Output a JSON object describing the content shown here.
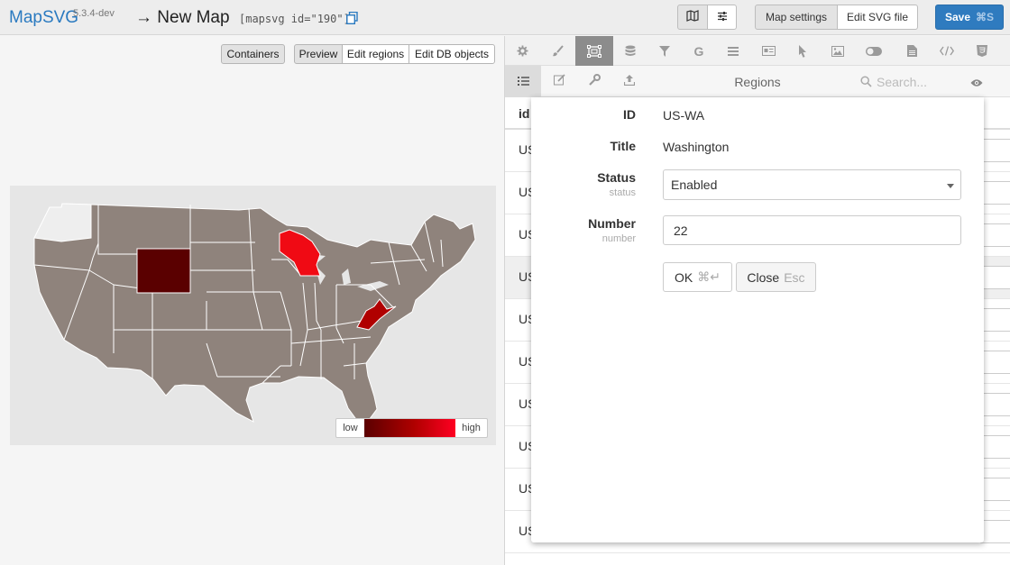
{
  "header": {
    "brand": "MapSVG",
    "version": "5.3.4-dev",
    "map_title": "→ New Map",
    "shortcode": "[mapsvg id=\"190\"]",
    "icons": {
      "copy": "copy-icon",
      "map": "map-icon",
      "sliders": "sliders-icon"
    },
    "map_settings_label": "Map settings",
    "edit_svg_label": "Edit SVG file",
    "save_label": "Save",
    "save_shortcut": "⌘S"
  },
  "map_pane": {
    "containers_label": "Containers",
    "mode_tabs": [
      "Preview",
      "Edit regions",
      "Edit DB objects"
    ],
    "active_mode": "Preview",
    "legend": {
      "low": "low",
      "high": "high"
    },
    "colors": {
      "base": "#8f837c",
      "wyoming": "#5a0000",
      "wisconsin": "#f00a14",
      "west_virginia": "#b00000",
      "washington": "#eeeeee"
    }
  },
  "panel": {
    "toolbar_icons": [
      "gear-icon",
      "brush-icon",
      "regions-icon",
      "database-icon",
      "filter-icon",
      "google-icon",
      "menu-icon",
      "details-icon",
      "cursor-icon",
      "image-icon",
      "toggle-icon",
      "file-icon",
      "code-icon",
      "css-icon"
    ],
    "active_tool": "regions-icon",
    "sub_icons": [
      "list-icon",
      "edit-icon",
      "wrench-icon",
      "upload-icon"
    ],
    "title": "Regions",
    "search_placeholder": "Search...",
    "table": {
      "header_id": "id",
      "rows": [
        "US",
        "US",
        "US",
        "US",
        "US",
        "US",
        "US",
        "US",
        "US",
        "US"
      ]
    }
  },
  "form": {
    "id_label": "ID",
    "id_value": "US-WA",
    "title_label": "Title",
    "title_value": "Washington",
    "status_label": "Status",
    "status_sub": "status",
    "status_value": "Enabled",
    "number_label": "Number",
    "number_sub": "number",
    "number_value": "22",
    "ok_label": "OK",
    "ok_hint": "⌘↵",
    "close_label": "Close",
    "close_hint": "Esc"
  }
}
